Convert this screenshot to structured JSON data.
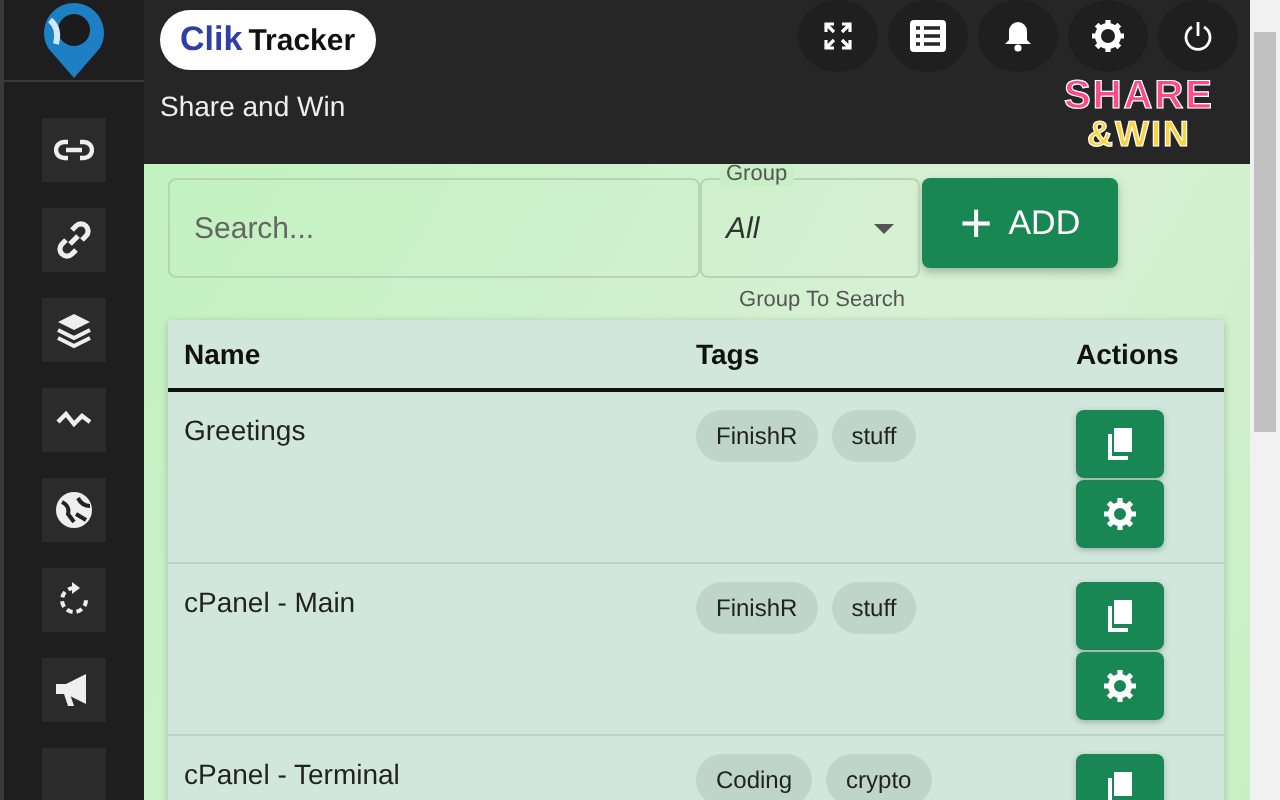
{
  "header": {
    "logo_text": {
      "first": "Clik",
      "second": "Tracker"
    },
    "subtitle": "Share and Win",
    "banner": {
      "line1": "SHARE",
      "line2": "&WIN"
    }
  },
  "sidebar": {
    "items": [
      {
        "kind": "link"
      },
      {
        "kind": "chain"
      },
      {
        "kind": "layers"
      },
      {
        "kind": "pulse"
      },
      {
        "kind": "globe"
      },
      {
        "kind": "refresh"
      },
      {
        "kind": "megaphone"
      },
      {
        "kind": "blank"
      }
    ]
  },
  "toolbar": {
    "buttons": [
      {
        "kind": "fullscreen"
      },
      {
        "kind": "list"
      },
      {
        "kind": "bell"
      },
      {
        "kind": "gear"
      },
      {
        "kind": "power"
      }
    ]
  },
  "search": {
    "placeholder": "Search..."
  },
  "group": {
    "label": "Group",
    "value": "All",
    "helper": "Group To Search"
  },
  "add_button": {
    "icon": "+",
    "label": "ADD"
  },
  "table": {
    "columns": [
      "Name",
      "Tags",
      "Actions"
    ],
    "rows": [
      {
        "name": "Greetings",
        "tags": [
          "FinishR",
          "stuff"
        ]
      },
      {
        "name": "cPanel - Main",
        "tags": [
          "FinishR",
          "stuff"
        ]
      },
      {
        "name": "cPanel - Terminal",
        "tags": [
          "Coding",
          "crypto"
        ]
      }
    ]
  }
}
